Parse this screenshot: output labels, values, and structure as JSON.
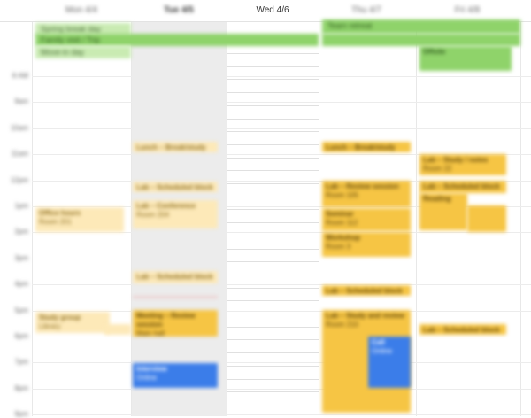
{
  "header": {
    "days": [
      {
        "label": "Mon 4/4"
      },
      {
        "label": "Tue 4/5"
      },
      {
        "label": "Wed 4/6"
      },
      {
        "label": "Thu 4/7"
      },
      {
        "label": "Fri 4/8"
      }
    ]
  },
  "allday": [
    {
      "label": "Spring break day",
      "color": "#8fd36a"
    },
    {
      "label": "Family visit / Trip",
      "color": "#8fd36a"
    },
    {
      "label": "Move-in day",
      "color": "#8fd36a"
    },
    {
      "label": "Team retreat",
      "color": "#8fd36a"
    },
    {
      "label": "Offsite",
      "color": "#8fd36a"
    }
  ],
  "hours": [
    "8 AM",
    "9am",
    "10am",
    "11am",
    "12pm",
    "1pm",
    "2pm",
    "3pm",
    "4pm",
    "5pm",
    "6pm",
    "7pm",
    "8pm",
    "9pm"
  ],
  "events": [
    {
      "title": "Lunch – Break/study",
      "sub": "",
      "color": "#fde9b8",
      "text_color": "#8a6b1c"
    },
    {
      "title": "Lab – Scheduled block",
      "sub": "",
      "color": "#fde9b8",
      "text_color": "#8a6b1c"
    },
    {
      "title": "Lab – Conference",
      "sub": "Room 204",
      "color": "#fde9b8",
      "text_color": "#8a6b1c"
    },
    {
      "title": "Office hours",
      "sub": "Room 201",
      "color": "#fde9b8",
      "text_color": "#8a6b1c"
    },
    {
      "title": "Lab – Scheduled block",
      "sub": "",
      "color": "#fde9b8",
      "text_color": "#8a6b1c"
    },
    {
      "title": "Study group",
      "sub": "Library",
      "color": "#fde9b8",
      "text_color": "#8a6b1c"
    },
    {
      "title": "Meeting – Review session",
      "sub": "Main hall",
      "color": "#f6c544",
      "text_color": "#5b4208"
    },
    {
      "title": "Interview",
      "sub": "Online",
      "color": "#3b7de9",
      "text_color": "#ffffff"
    },
    {
      "title": "Lunch – Break/study",
      "sub": "",
      "color": "#f6c544",
      "text_color": "#5b4208"
    },
    {
      "title": "Lab – Review session",
      "sub": "Room 105",
      "color": "#f6c544",
      "text_color": "#5b4208"
    },
    {
      "title": "Seminar",
      "sub": "Room 112",
      "color": "#f6c544",
      "text_color": "#5b4208"
    },
    {
      "title": "Workshop",
      "sub": "Room 3",
      "color": "#f6c544",
      "text_color": "#5b4208"
    },
    {
      "title": "Lab – Scheduled block",
      "sub": "",
      "color": "#f6c544",
      "text_color": "#5b4208"
    },
    {
      "title": "Lab – Study and review",
      "sub": "Room 210",
      "color": "#f6c544",
      "text_color": "#5b4208"
    },
    {
      "title": "Call",
      "sub": "Online",
      "color": "#3b7de9",
      "text_color": "#ffffff"
    },
    {
      "title": "Lab – Study / notes",
      "sub": "Room 22",
      "color": "#f6c544",
      "text_color": "#5b4208"
    },
    {
      "title": "Lab – Scheduled block",
      "sub": "",
      "color": "#f6c544",
      "text_color": "#5b4208"
    },
    {
      "title": "Reading",
      "sub": "",
      "color": "#f6c544",
      "text_color": "#5b4208"
    },
    {
      "title": "Lab – Scheduled block",
      "sub": "",
      "color": "#f6c544",
      "text_color": "#5b4208"
    }
  ]
}
